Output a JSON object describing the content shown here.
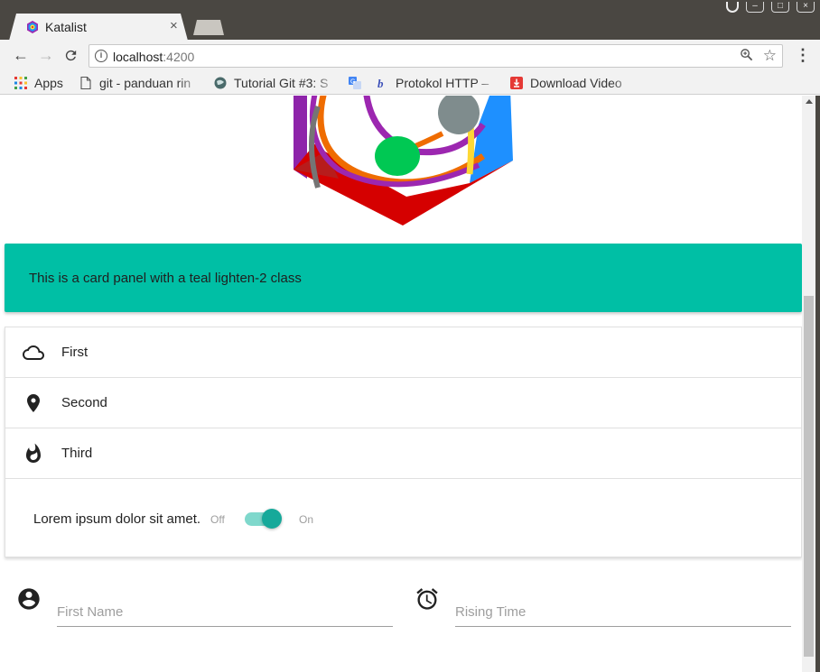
{
  "browser": {
    "tab_title": "Katalist",
    "tab_close": "×",
    "url_host": "localhost",
    "url_port": ":4200",
    "bookmarks": [
      {
        "label": "Apps",
        "icon": "apps-grid-icon"
      },
      {
        "label": "git - panduan rin",
        "icon": "page-icon"
      },
      {
        "label": "Tutorial Git #3: S",
        "icon": "globe-icon"
      },
      {
        "label": "",
        "icon": "translate-icon"
      },
      {
        "label": "Protokol HTTP –",
        "icon": "bold-b-icon"
      },
      {
        "label": "Download Video",
        "icon": "download-red-icon"
      }
    ]
  },
  "page": {
    "card_panel_text": "This is a card panel with a teal lighten-2 class",
    "collection": [
      {
        "label": "First",
        "icon": "cloud-icon"
      },
      {
        "label": "Second",
        "icon": "location-pin-icon"
      },
      {
        "label": "Third",
        "icon": "fire-icon"
      }
    ],
    "switch": {
      "label": "Lorem ipsum dolor sit amet.",
      "off_label": "Off",
      "on_label": "On",
      "checked": true
    },
    "form": {
      "first_name_placeholder": "First Name",
      "rising_time_placeholder": "Rising Time"
    }
  },
  "colors": {
    "card_panel": "#00bfa5",
    "switch_knob": "#16a99a",
    "switch_track": "#7fd8cc",
    "chrome_dark": "#4a4742"
  }
}
